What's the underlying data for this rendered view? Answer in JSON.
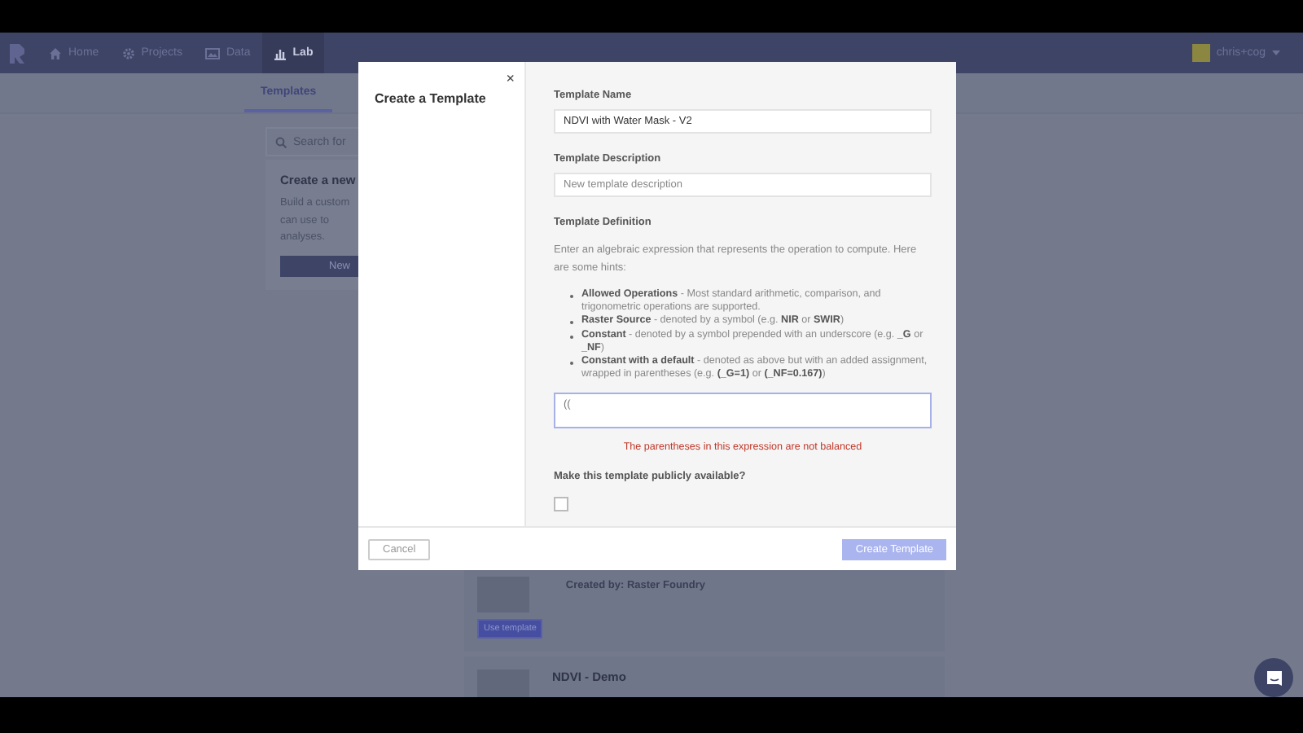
{
  "nav": {
    "items": [
      {
        "label": "Home",
        "selected": false
      },
      {
        "label": "Projects",
        "selected": false
      },
      {
        "label": "Data",
        "selected": false
      },
      {
        "label": "Lab",
        "selected": true
      }
    ],
    "user": "chris+cog"
  },
  "tabs": [
    {
      "label": "Templates",
      "selected": true
    }
  ],
  "sidebar": {
    "search_placeholder": "Search for",
    "card": {
      "title": "Create a new",
      "lines": [
        "Build a custom",
        "can use to",
        "analyses."
      ],
      "button": "New"
    }
  },
  "template_list": [
    {
      "created_by": "Created by: Raster Foundry",
      "button": "Use template"
    },
    {
      "title": "NDVI - Demo"
    }
  ],
  "modal": {
    "title": "Create a Template",
    "close": "×",
    "fields": [
      {
        "label": "Template Name",
        "value": "NDVI with Water Mask - V2"
      },
      {
        "label": "Template Description",
        "placeholder": "New template description"
      }
    ],
    "definition": {
      "label": "Template Definition",
      "intro": "Enter an algebraic expression that represents the operation to compute. Here are some hints:",
      "hints": [
        "**Allowed Operations** - Most standard arithmetic, comparison, and trigonometric operations are supported.",
        "**Raster Source** - denoted by a symbol (e.g. **NIR** or **SWIR**)",
        "**Constant** - denoted by a symbol prepended with an underscore (e.g. **_G** or **_NF**)",
        "**Constant with a default** - denoted as above but with an added assignment, wrapped in parentheses (e.g. **(_G=1)** or **(_NF=0.167)**)"
      ],
      "value": "((",
      "error": "The parentheses in this expression are not balanced"
    },
    "public": {
      "label": "Make this template publicly available?",
      "checked": false
    },
    "cancel": "Cancel",
    "create": {
      "label": "Create Template",
      "disabled": true
    }
  }
}
